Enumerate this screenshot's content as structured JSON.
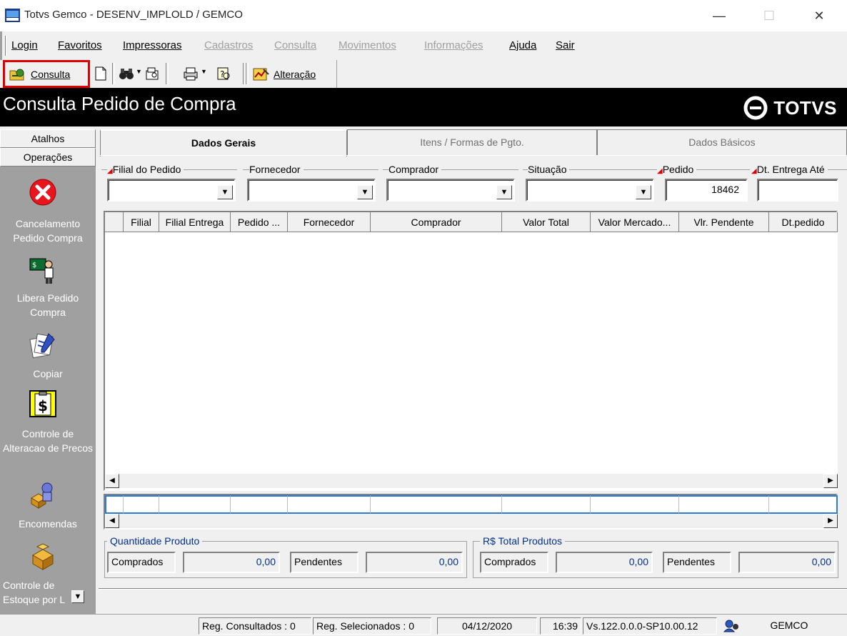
{
  "window": {
    "title": "Totvs Gemco - DESENV_IMPLOLD / GEMCO",
    "minimize_icon": "minimize-icon",
    "maximize_icon": "maximize-icon",
    "close_icon": "close-icon"
  },
  "menu": [
    {
      "label": "Login",
      "enabled": true
    },
    {
      "label": "Favoritos",
      "enabled": true
    },
    {
      "label": "Impressoras",
      "enabled": true
    },
    {
      "label": "Cadastros",
      "enabled": false
    },
    {
      "label": "Consulta",
      "enabled": false
    },
    {
      "label": "Movimentos",
      "enabled": false
    },
    {
      "label": "Informações",
      "enabled": false
    },
    {
      "label": "Ajuda",
      "enabled": true
    },
    {
      "label": "Sair",
      "enabled": true
    }
  ],
  "toolbar": {
    "consulta_label": "Consulta",
    "alteracao_label": "Alteração"
  },
  "header": {
    "page_title": "Consulta Pedido de Compra",
    "logo_text": "TOTVS"
  },
  "sidebar": {
    "tabs": [
      "Atalhos",
      "Operações"
    ],
    "items": [
      {
        "label": "Cancelamento Pedido Compra",
        "icon": "cancel-icon"
      },
      {
        "label": "Libera Pedido Compra",
        "icon": "release-order-icon"
      },
      {
        "label": "Copiar",
        "icon": "copy-icon"
      },
      {
        "label": "Controle de Alteracao de Precos",
        "icon": "price-control-icon"
      },
      {
        "label": "Encomendas",
        "icon": "orders-icon"
      },
      {
        "label": "Controle de Estoque por L",
        "icon": "stock-control-icon"
      }
    ]
  },
  "tabs": [
    {
      "label": "Dados Gerais",
      "active": true
    },
    {
      "label": "Itens / Formas de Pgto.",
      "active": false
    },
    {
      "label": "Dados Básicos",
      "active": false
    }
  ],
  "filters": {
    "filial_label": "Filial do Pedido",
    "fornecedor_label": "Fornecedor",
    "comprador_label": "Comprador",
    "situacao_label": "Situação",
    "pedido_label": "Pedido",
    "pedido_value": "18462",
    "dt_entrega_label": "Dt. Entrega Até"
  },
  "grid": {
    "columns": [
      "Filial",
      "Filial Entrega",
      "Pedido ...",
      "Fornecedor",
      "Comprador",
      "Valor Total",
      "Valor Mercado...",
      "Vlr. Pendente",
      "Dt.pedido"
    ],
    "rows": []
  },
  "summary": {
    "quantidade_title": "Quantidade Produto",
    "total_title": "R$ Total Produtos",
    "comprados_label": "Comprados",
    "pendentes_label": "Pendentes",
    "qtd_comprados": "0,00",
    "qtd_pendentes": "0,00",
    "total_comprados": "0,00",
    "total_pendentes": "0,00"
  },
  "status": {
    "reg_consultados": "Reg. Consultados : 0",
    "reg_selecionados": "Reg. Selecionados : 0",
    "date": "04/12/2020",
    "time": "16:39",
    "version": "Vs.122.0.0.0-SP10.00.12",
    "module": "GEMCO"
  },
  "colors": {
    "header_bg": "#000000",
    "highlight_red": "#e00000",
    "sidebar_bg": "#a0a0a0",
    "summary_title": "#00308f"
  }
}
